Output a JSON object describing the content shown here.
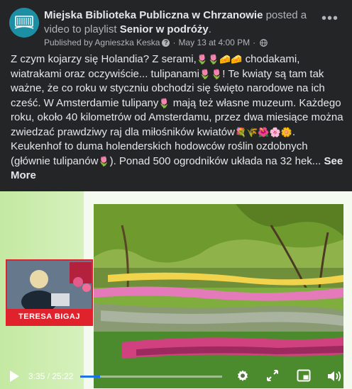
{
  "header": {
    "page_name": "Miejska Biblioteka Publiczna w Chrzanowie",
    "action_text": "posted a video to playlist",
    "playlist": "Senior w podróży",
    "period": ".",
    "published_by": "Published by Agnieszka Keska",
    "help_glyph": "?",
    "date": "May 13 at 4:00 PM",
    "separator": "·",
    "more_glyph": "•••"
  },
  "post": {
    "seg1": "Z czym kojarzy się Holandia? Z serami,",
    "emo1": "🌷🌷🧀🧀",
    "seg2": " chodakami, wiatrakami oraz oczywiście... tulipanami",
    "emo2": "🌷🌷",
    "seg3": "! Te kwiaty są tam tak ważne, że co roku w styczniu obchodzi się święto narodowe na ich cześć. W Amsterdamie tulipany",
    "emo3": "🌷",
    "seg4": " mają też własne muzeum. Każdego roku, około 40 kilometrów od Amsterdamu, przez dwa miesiące można zwiedzać prawdziwy raj dla miłośników kwiatów",
    "emo4": "💐🌾🌺🌸🌼",
    "seg5": ". Keukenhof to duma holenderskich hodowców roślin ozdobnych (głównie tulipanów",
    "emo5": "🌷",
    "seg6": "). Ponad 500 ogrodników układa na 32 hek... ",
    "see_more": "See More"
  },
  "video": {
    "webcam_label": "TERESA BIGAJ",
    "current_time": "3:35",
    "time_separator": " / ",
    "duration": "25:22",
    "progress_fraction": 0.141
  },
  "colors": {
    "background": "#242526",
    "text_primary": "#e4e6eb",
    "text_secondary": "#b0b3b8",
    "progress_accent": "#1b74e4",
    "label_red": "#e0222d",
    "avatar_teal": "#1d8fa5"
  },
  "icons": {
    "avatar": "library-logo-icon",
    "help": "question-circle-icon",
    "privacy": "globe-icon",
    "more": "more-dots-icon",
    "play": "play-icon",
    "settings": "gear-icon",
    "fullscreen": "expand-icon",
    "miniplayer": "miniplayer-icon",
    "volume": "volume-icon"
  }
}
